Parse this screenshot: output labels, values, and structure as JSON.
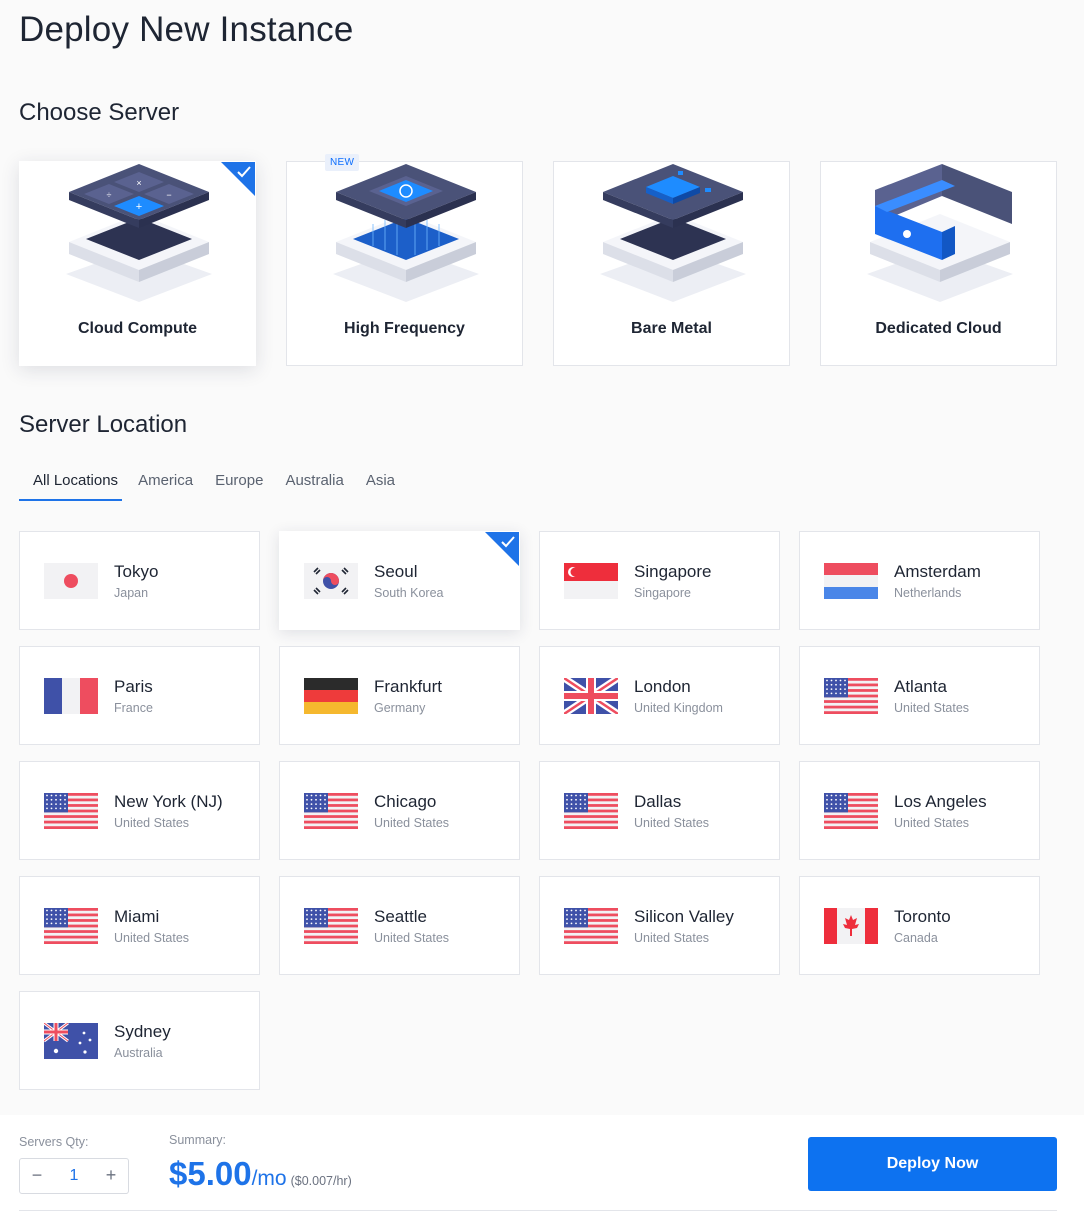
{
  "page": {
    "title": "Deploy New Instance"
  },
  "choose_server": {
    "title": "Choose Server",
    "cards": [
      {
        "label": "Cloud Compute",
        "selected": true
      },
      {
        "label": "High Frequency",
        "badge": "NEW",
        "selected": false
      },
      {
        "label": "Bare Metal",
        "selected": false
      },
      {
        "label": "Dedicated Cloud",
        "selected": false
      }
    ]
  },
  "server_location": {
    "title": "Server Location",
    "tabs": [
      {
        "label": "All Locations",
        "active": true
      },
      {
        "label": "America"
      },
      {
        "label": "Europe"
      },
      {
        "label": "Australia"
      },
      {
        "label": "Asia"
      }
    ],
    "locations": [
      {
        "city": "Tokyo",
        "country": "Japan",
        "flag": "jp"
      },
      {
        "city": "Seoul",
        "country": "South Korea",
        "flag": "kr",
        "selected": true
      },
      {
        "city": "Singapore",
        "country": "Singapore",
        "flag": "sg"
      },
      {
        "city": "Amsterdam",
        "country": "Netherlands",
        "flag": "nl"
      },
      {
        "city": "Paris",
        "country": "France",
        "flag": "fr"
      },
      {
        "city": "Frankfurt",
        "country": "Germany",
        "flag": "de"
      },
      {
        "city": "London",
        "country": "United Kingdom",
        "flag": "gb"
      },
      {
        "city": "Atlanta",
        "country": "United States",
        "flag": "us"
      },
      {
        "city": "New York (NJ)",
        "country": "United States",
        "flag": "us"
      },
      {
        "city": "Chicago",
        "country": "United States",
        "flag": "us"
      },
      {
        "city": "Dallas",
        "country": "United States",
        "flag": "us"
      },
      {
        "city": "Los Angeles",
        "country": "United States",
        "flag": "us"
      },
      {
        "city": "Miami",
        "country": "United States",
        "flag": "us"
      },
      {
        "city": "Seattle",
        "country": "United States",
        "flag": "us"
      },
      {
        "city": "Silicon Valley",
        "country": "United States",
        "flag": "us"
      },
      {
        "city": "Toronto",
        "country": "Canada",
        "flag": "ca"
      },
      {
        "city": "Sydney",
        "country": "Australia",
        "flag": "au"
      }
    ]
  },
  "footer": {
    "qty_label": "Servers Qty:",
    "qty_value": "1",
    "minus": "−",
    "plus": "+",
    "summary_label": "Summary:",
    "price_amount": "$5.00",
    "price_per": "/mo",
    "price_hourly": "($0.007/hr)",
    "deploy_label": "Deploy Now"
  },
  "colors": {
    "accent": "#0d72f0",
    "text": "#1e2533",
    "muted": "#8a909c",
    "border": "#e3e5ea"
  }
}
